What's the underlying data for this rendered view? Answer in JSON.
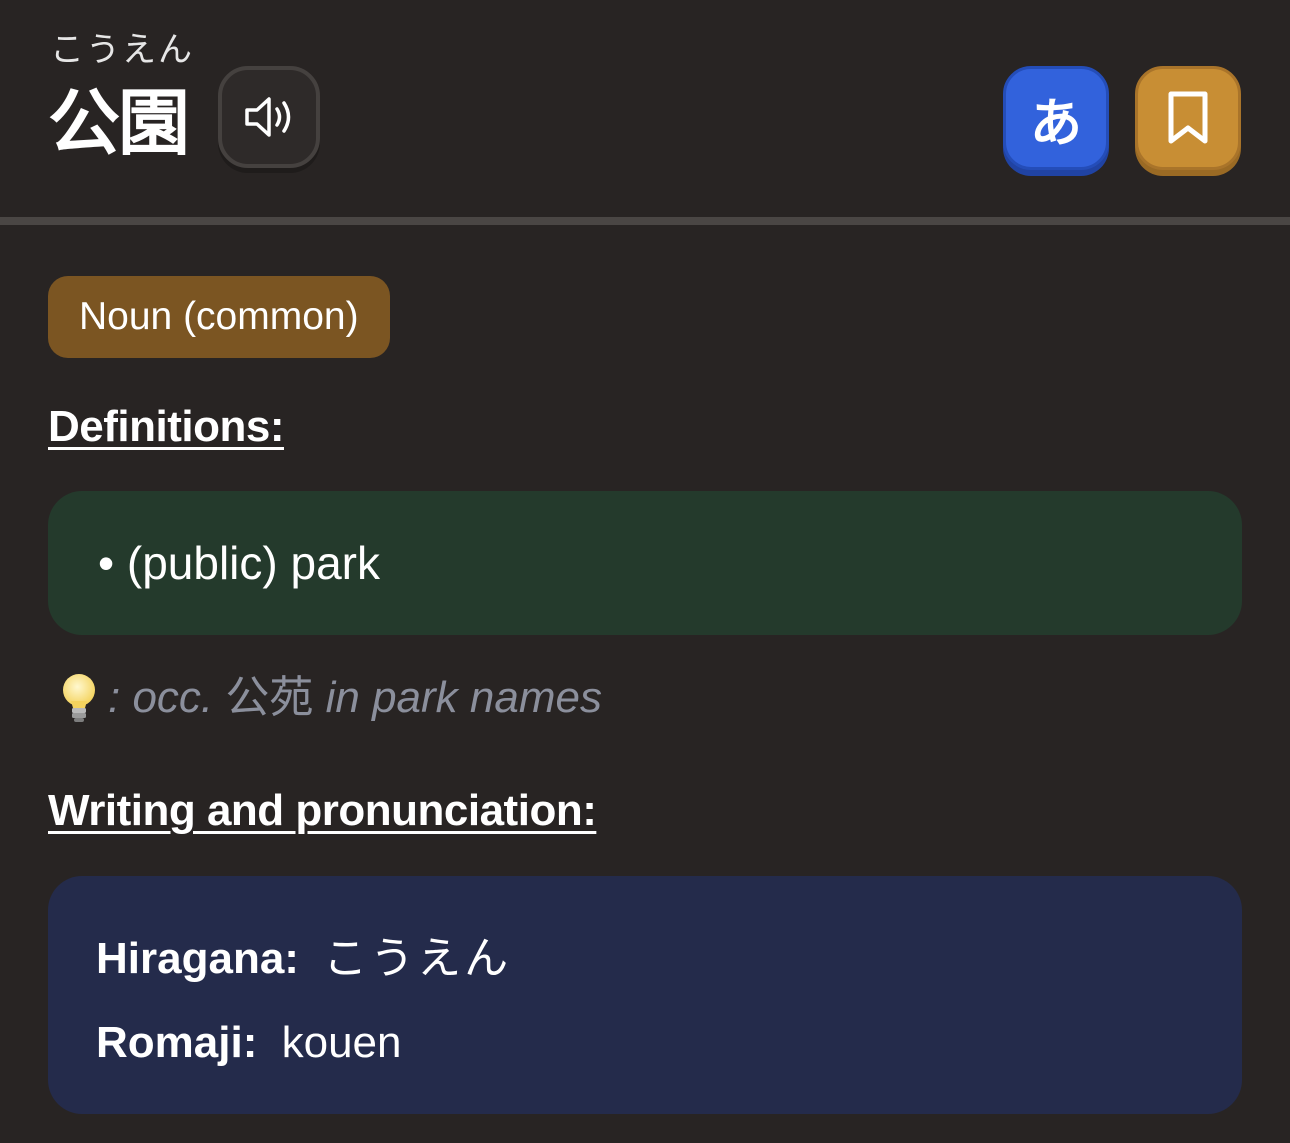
{
  "header": {
    "furigana": "こうえん",
    "word": "公園",
    "kana_button_label": "あ",
    "audio_icon": "speaker-icon",
    "bookmark_icon": "bookmark-icon"
  },
  "part_of_speech": "Noun (common)",
  "definitions": {
    "title": "Definitions:",
    "items": [
      "• (public) park"
    ]
  },
  "note": {
    "icon": "lightbulb-icon",
    "prefix": ": occ. ",
    "kanji": "公苑",
    "suffix": " in park names"
  },
  "writing": {
    "title": "Writing and pronunciation:",
    "hiragana_label": "Hiragana:",
    "hiragana_value": "こうえん",
    "romaji_label": "Romaji:",
    "romaji_value": "kouen"
  },
  "colors": {
    "background": "#282423",
    "kana_button": "#3262dc",
    "bookmark_button": "#c88e34",
    "pos_badge": "#7b5522",
    "definition_box": "#243a2c",
    "writing_box": "#242b4b",
    "note_text": "#8b8f9c"
  }
}
